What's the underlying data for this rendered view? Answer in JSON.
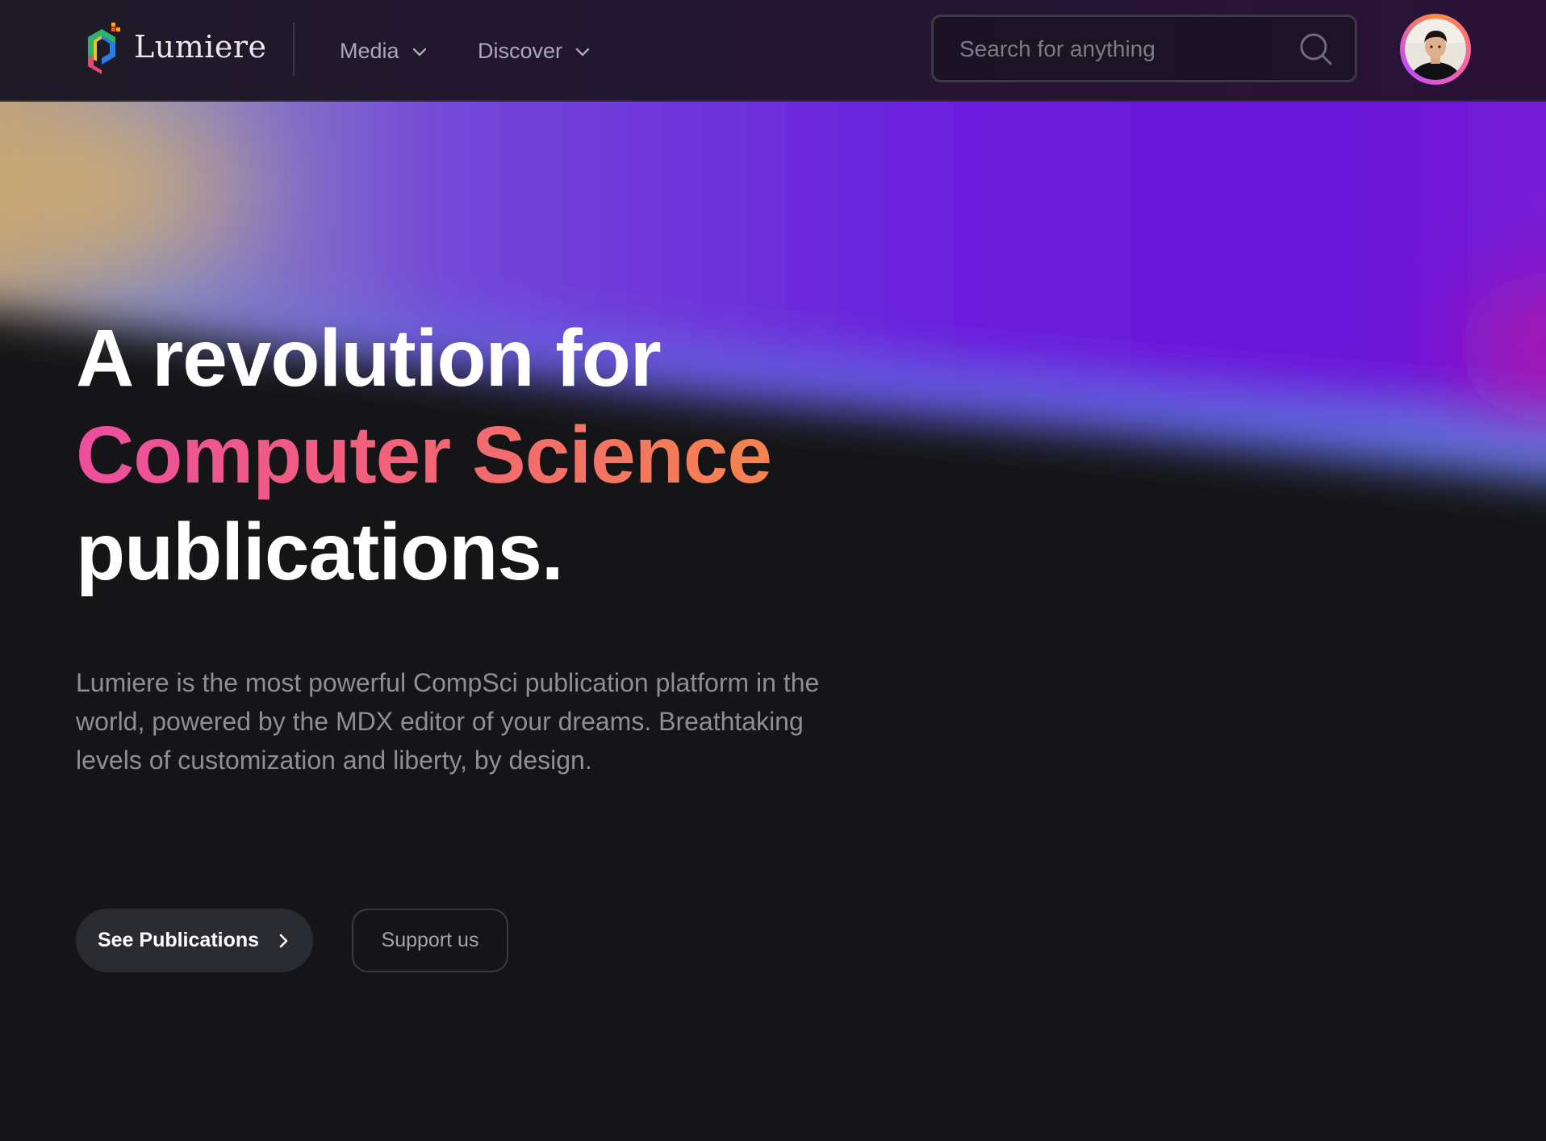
{
  "header": {
    "brand": "Lumiere",
    "nav": [
      {
        "label": "Media"
      },
      {
        "label": "Discover"
      }
    ],
    "search": {
      "placeholder": "Search for anything",
      "value": ""
    }
  },
  "hero": {
    "headline_line1": "A revolution for",
    "headline_accent": "Computer Science",
    "headline_line3": "publications.",
    "description": "Lumiere is the most powerful CompSci publication platform in the world, powered by the MDX editor of your dreams. Breathtaking levels of customization and liberty, by design.",
    "primary_button": "See Publications",
    "secondary_button": "Support us"
  },
  "icons": {
    "logo": "lumiere-logo-icon",
    "nav_chevron": "chevron-down-icon",
    "search": "search-icon",
    "button_arrow": "chevron-right-icon",
    "avatar": "user-avatar"
  },
  "colors": {
    "background": "#151517",
    "accent_pink": "#ec4f9e",
    "accent_orange": "#f4844f",
    "gradient_purple": "#6c14d9",
    "gradient_blue": "#4f8fd8",
    "text_primary": "#ffffff",
    "text_muted": "#8e8e99"
  }
}
